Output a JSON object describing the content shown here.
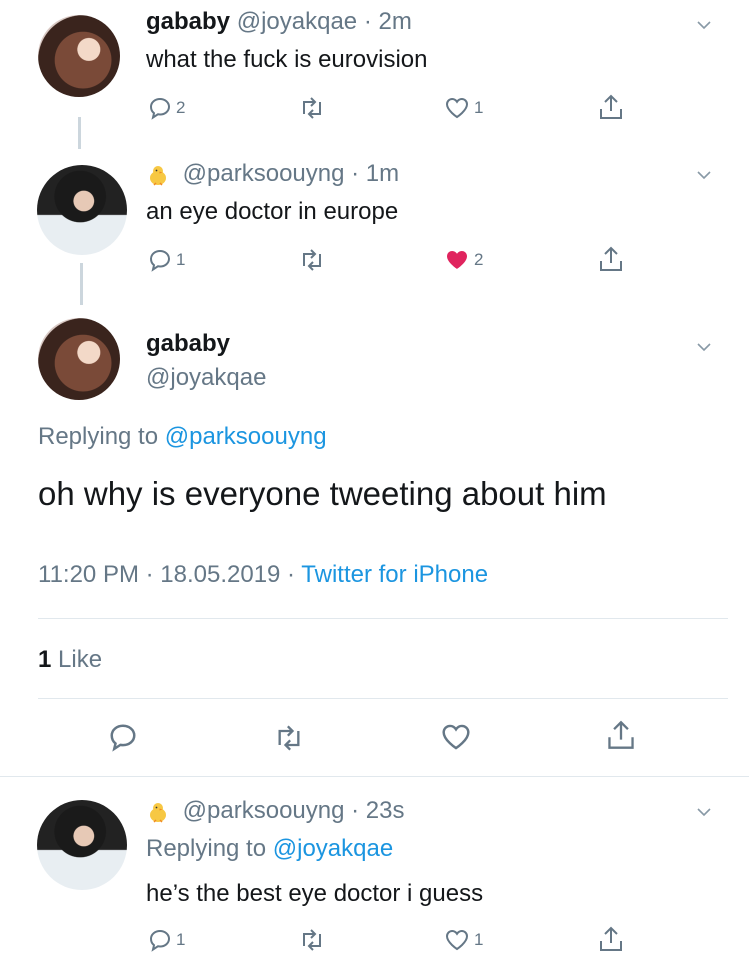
{
  "tweet1": {
    "display_name": "gababy",
    "handle": "@joyakqae",
    "time": "· 2m",
    "text": "what the fuck is eurovision",
    "reply_count": "2",
    "like_count": "1"
  },
  "tweet2": {
    "handle": "@parksoouyng",
    "time": "· 1m",
    "text": "an eye doctor in europe",
    "reply_count": "1",
    "like_count": "2",
    "liked_color": "#e0245e"
  },
  "main": {
    "display_name": "gababy",
    "handle": "@joyakqae",
    "replying_prefix": "Replying to",
    "replying_handle": "@parksoouyng",
    "text": "oh why is everyone tweeting about him",
    "timestamp": "11:20 PM · 18.05.2019 ·",
    "source": "Twitter for iPhone",
    "likes_count": "1",
    "likes_label": "Like"
  },
  "reply": {
    "handle": "@parksoouyng",
    "time": "· 23s",
    "replying_prefix": "Replying to",
    "replying_handle": "@joyakqae",
    "text": "he’s the best eye doctor i guess",
    "reply_count": "1",
    "like_count": "1"
  },
  "colors": {
    "link": "#1b95e0",
    "muted": "#657786",
    "like_red": "#e0245e"
  }
}
